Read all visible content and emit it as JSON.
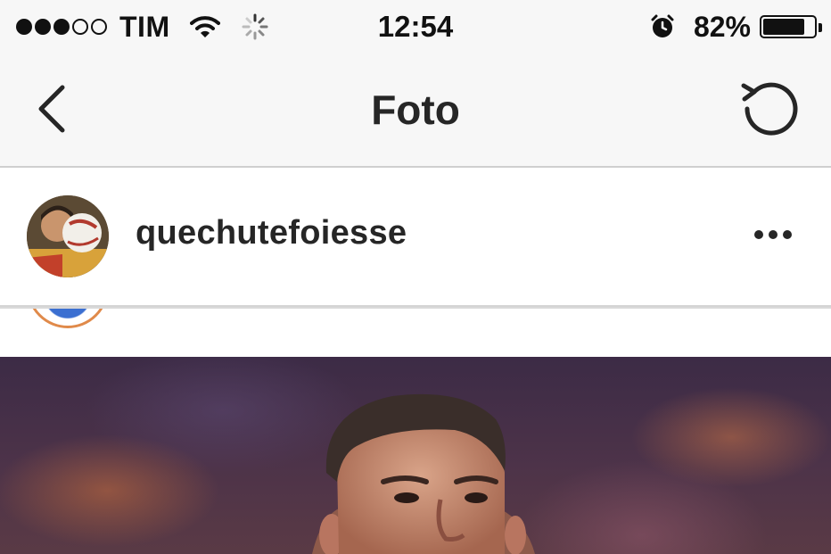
{
  "status_bar": {
    "carrier": "TIM",
    "signal_bars_filled": 3,
    "signal_bars_total": 5,
    "time": "12:54",
    "battery_percent": "82%",
    "battery_level": 0.82,
    "icons": [
      "signal-dots-icon",
      "wifi-icon",
      "activity-spinner-icon",
      "alarm-icon",
      "battery-icon"
    ]
  },
  "nav": {
    "title": "Foto",
    "back_icon": "chevron-left-icon",
    "refresh_icon": "refresh-icon"
  },
  "post": {
    "username": "quechutefoiesse",
    "more_icon": "more-horizontal-icon"
  },
  "colors": {
    "bar_background": "#f7f7f7",
    "text": "#262626",
    "divider": "#cfcfcf"
  }
}
